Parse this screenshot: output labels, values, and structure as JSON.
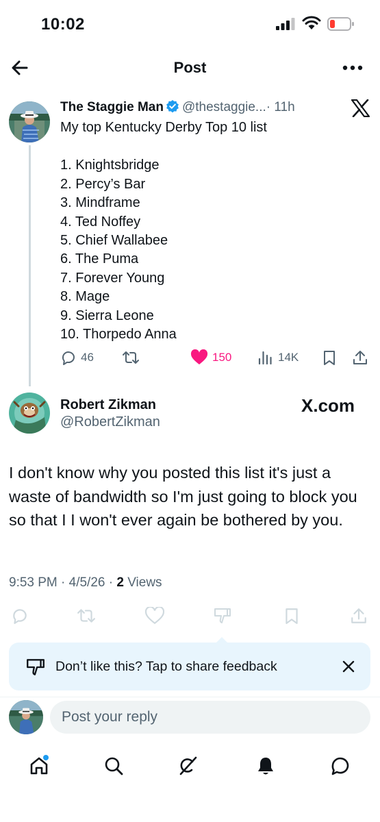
{
  "status_bar": {
    "time": "10:02"
  },
  "header": {
    "title": "Post"
  },
  "tweet": {
    "name": "The Staggie Man",
    "handle": "@thestaggie...",
    "time": "· 11h",
    "intro": "My top Kentucky Derby Top 10 list",
    "list": [
      "1. Knightsbridge",
      "2. Percy’s Bar",
      "3. Mindframe",
      "4. Ted Noffey",
      "5. Chief Wallabee",
      "6. The Puma",
      "7. Forever Young",
      "8. Mage",
      "9. Sierra Leone",
      "10. Thorpedo Anna"
    ],
    "replies": "46",
    "likes": "150",
    "views": "14K"
  },
  "reply": {
    "name": "Robert Zikman",
    "handle": "@RobertZikman",
    "watermark": "X.com",
    "text": "I don't know why you posted this list it's just a waste of bandwidth so I'm just going to block you so that I I won't ever again be bothered by you.",
    "timestamp": "9:53 PM · 4/5/26 · ",
    "views_count": "2",
    "views_label": " Views"
  },
  "feedback": {
    "text": "Don’t like this? Tap to share feedback"
  },
  "composer": {
    "placeholder": "Post your reply"
  },
  "colors": {
    "like": "#f91880",
    "accent": "#1d9bf0",
    "muted": "#536471",
    "banner": "#e8f5fd"
  },
  "icons": [
    "back-arrow-icon",
    "more-icon",
    "verified-badge-icon",
    "x-logo-icon",
    "reply-icon",
    "repost-icon",
    "heart-icon",
    "views-icon",
    "bookmark-icon",
    "share-icon",
    "dislike-icon",
    "close-icon",
    "home-icon",
    "search-icon",
    "grok-icon",
    "notifications-icon",
    "messages-icon"
  ]
}
